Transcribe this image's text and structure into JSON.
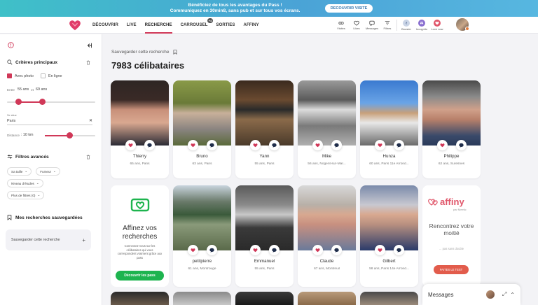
{
  "promo": {
    "line1": "Bénéficiez de tous les avantages du Pass !",
    "line2": "Communiquez en 30min8, sans pub et sur tous vos écrans.",
    "button": "DECOUVRIR VISITE"
  },
  "nav": {
    "links": [
      {
        "label": "DÉCOUVRIR"
      },
      {
        "label": "LIVE"
      },
      {
        "label": "RECHERCHE"
      },
      {
        "label": "CARROUSEL",
        "badge": "+4"
      },
      {
        "label": "SORTIES"
      },
      {
        "label": "AFFINY"
      }
    ],
    "icons": [
      {
        "label": "Visites",
        "icon": "eyes-icon"
      },
      {
        "label": "Likes",
        "icon": "heart-icon"
      },
      {
        "label": "Messages",
        "icon": "chat-icon"
      },
      {
        "label": "Filtres",
        "icon": "filter-icon"
      },
      {
        "label": "Booster",
        "icon": "booster-icon"
      },
      {
        "label": "Incognito",
        "icon": "incognito-icon"
      },
      {
        "label": "Love now",
        "icon": "love-now-icon"
      }
    ]
  },
  "sidebar": {
    "criteria_title": "Critères principaux",
    "with_photo": "Avec photo",
    "online": "En ligne",
    "age_prefix": "Entre",
    "age_min": "55 ans",
    "age_and": "et",
    "age_max": "69 ans",
    "city_label": "Se situe",
    "city_value": "Paris",
    "distance_label": "Distance",
    "distance_value": ": 10 km",
    "advanced_title": "Filtres avancés",
    "chips": [
      "Sa taille",
      "Fumeur",
      "Niveau d'études",
      "Plus de filtres (0)"
    ],
    "saved_title": "Mes recherches sauvegardées",
    "saved_button": "Sauvegarder cette recherche",
    "colors": {
      "accent": "#d03858"
    }
  },
  "main": {
    "save_search": "Sauvegarder cette recherche",
    "count": "7983 célibataires",
    "row1": [
      {
        "name": "Thierry",
        "meta": "65 ans, Paris"
      },
      {
        "name": "Bruno",
        "meta": "63 ans, Paris"
      },
      {
        "name": "Yann",
        "meta": "55 ans, Paris"
      },
      {
        "name": "Mike",
        "meta": "56 ans, Nogent-sur-Mar..."
      },
      {
        "name": "Hunza",
        "meta": "60 ans, Paris 11e Arrond..."
      },
      {
        "name": "Philippe",
        "meta": "62 ans, Suresnes"
      }
    ],
    "row2": [
      {
        "name": "petitpierre",
        "meta": "61 ans, Montrouge"
      },
      {
        "name": "Emmanuel",
        "meta": "55 ans, Paris"
      },
      {
        "name": "Claude",
        "meta": "67 ans, Montreuil"
      },
      {
        "name": "Gilbert",
        "meta": "58 ans, Paris 14e Arrond..."
      }
    ],
    "promo_card": {
      "title": "Affinez vos recherches",
      "text": "Connectez-vous sur les célibataires qui vous correspondent vraiment grâce aux pass",
      "button": "Découvrir les pass"
    },
    "affiny_card": {
      "logo": "affiny",
      "sub": "par Meetic",
      "title": "Rencontrez votre moitié",
      "text": "... pas sans double",
      "button": "FAITES LE TEST"
    }
  },
  "messages": {
    "label": "Messages"
  }
}
